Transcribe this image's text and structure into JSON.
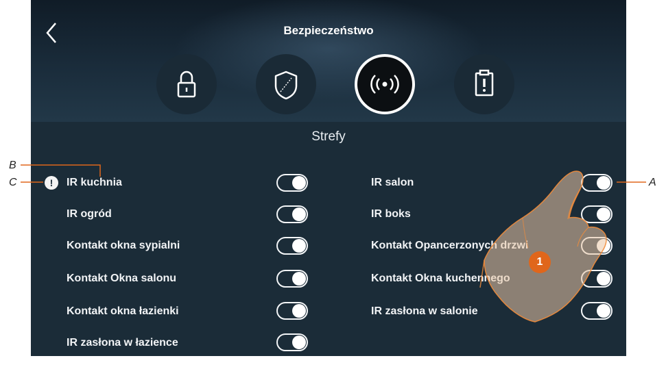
{
  "header": {
    "title": "Bezpieczeństwo"
  },
  "tabs": [
    {
      "icon": "lock-icon"
    },
    {
      "icon": "shield-icon"
    },
    {
      "icon": "zones-icon",
      "active": true
    },
    {
      "icon": "alert-clipboard-icon"
    }
  ],
  "section": {
    "title": "Strefy"
  },
  "zones_left": [
    {
      "label": "IR kuchnia",
      "on": true,
      "warning": true
    },
    {
      "label": "IR ogród",
      "on": true
    },
    {
      "label": "Kontakt okna sypialni",
      "on": true
    },
    {
      "label": "Kontakt Okna salonu",
      "on": true
    },
    {
      "label": "Kontakt okna łazienki",
      "on": true
    },
    {
      "label": "IR zasłona w łazience",
      "on": true
    }
  ],
  "zones_right": [
    {
      "label": "IR salon",
      "on": true
    },
    {
      "label": "IR boks",
      "on": true
    },
    {
      "label": "Kontakt Opancerzonych drzwi",
      "on": true
    },
    {
      "label": "Kontakt Okna kuchennego",
      "on": true
    },
    {
      "label": "IR zasłona w salonie",
      "on": true
    }
  ],
  "warning_symbol": "!",
  "callouts": {
    "a": "A",
    "b": "B",
    "c": "C"
  },
  "step_badge": "1",
  "colors": {
    "background": "#1b2c38",
    "accent": "#e0661b",
    "toggle": "#ffffff"
  }
}
